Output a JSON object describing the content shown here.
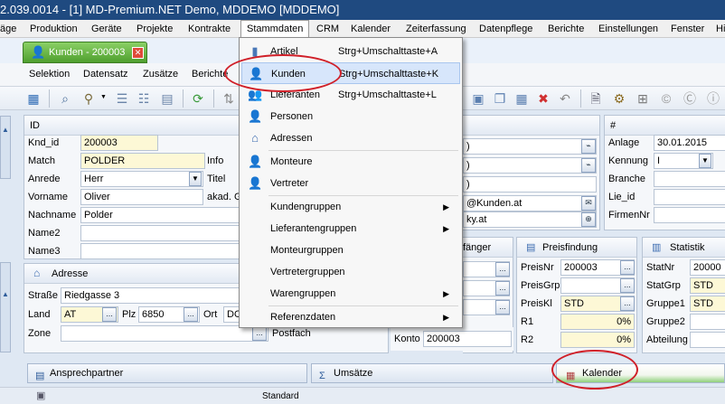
{
  "title": "2.039.0014 - [1] MD-Premium.NET Demo, MDDEMO [MDDEMO]",
  "menu": [
    "äge",
    "Produktion",
    "Geräte",
    "Projekte",
    "Kontrakte",
    "Stammdaten",
    "CRM",
    "Kalender",
    "Zeiterfassung",
    "Datenpflege",
    "Berichte",
    "Einstellungen",
    "Fenster",
    "Hilfe"
  ],
  "doc_tab": {
    "label": "Kunden - 200003"
  },
  "submenu": [
    "Selektion",
    "Datensatz",
    "Zusätze",
    "Berichte"
  ],
  "dropdown": [
    {
      "label": "Artikel",
      "shortcut": "Strg+Umschalttaste+A",
      "icon": "article-icon"
    },
    {
      "label": "Kunden",
      "shortcut": "Strg+Umschalttaste+K",
      "icon": "customer-icon",
      "highlighted": true
    },
    {
      "label": "Lieferanten",
      "shortcut": "Strg+Umschalttaste+L",
      "icon": "supplier-icon"
    },
    {
      "label": "Personen",
      "shortcut": "",
      "icon": "person-icon"
    },
    {
      "label": "Adressen",
      "shortcut": "",
      "icon": "address-icon"
    },
    {
      "label": "Monteure",
      "shortcut": "",
      "icon": "fitter-icon"
    },
    {
      "label": "Vertreter",
      "shortcut": "",
      "icon": "representative-icon"
    },
    {
      "label": "Kundengruppen",
      "shortcut": "",
      "submenu": true
    },
    {
      "label": "Lieferantengruppen",
      "shortcut": "",
      "submenu": true
    },
    {
      "label": "Monteurgruppen",
      "shortcut": "",
      "submenu": false
    },
    {
      "label": "Vertretergruppen",
      "shortcut": "",
      "submenu": false
    },
    {
      "label": "Warengruppen",
      "shortcut": "",
      "submenu": true
    },
    {
      "label": "Referenzdaten",
      "shortcut": "",
      "submenu": true
    }
  ],
  "id_panel": {
    "header": "ID",
    "knd_id_label": "Knd_id",
    "knd_id": "200003",
    "match_label": "Match",
    "match": "POLDER",
    "anrede_label": "Anrede",
    "anrede": "Herr",
    "vorname_label": "Vorname",
    "vorname": "Oliver",
    "nachname_label": "Nachname",
    "nachname": "Polder",
    "name2_label": "Name2",
    "name3_label": "Name3",
    "info_label": "Info",
    "titel_label": "Titel",
    "akad_label": "akad. G"
  },
  "contact_partial": {
    "r1": ")",
    "r2": ")",
    "r3": ")",
    "r4": "@Kunden.at",
    "r5": "ky.at"
  },
  "right_panel": {
    "header": "#",
    "anlage_label": "Anlage",
    "anlage": "30.01.2015",
    "kennung_label": "Kennung",
    "kennung": "I",
    "branche_label": "Branche",
    "lie_id_label": "Lie_id",
    "firmennr_label": "FirmenNr"
  },
  "adresse_panel": {
    "header": "Adresse",
    "strasse_label": "Straße",
    "strasse": "Riedgasse 3",
    "land_label": "Land",
    "land": "AT",
    "plz_label": "Plz",
    "plz": "6850",
    "ort_label": "Ort",
    "ort": "DO",
    "zone_label": "Zone",
    "postfach_label": "Postfach"
  },
  "empfaenger_panel": {
    "header": "fänger",
    "konto_label": "Konto",
    "konto": "200003"
  },
  "preisfindung_panel": {
    "header": "Preisfindung",
    "preisnr_label": "PreisNr",
    "preisnr": "200003",
    "preisgrp_label": "PreisGrp",
    "preiskl_label": "PreisKl",
    "preiskl": "STD",
    "r1_label": "R1",
    "r1": "0%",
    "r2_label": "R2",
    "r2": "0%"
  },
  "statistik_panel": {
    "header": "Statistik",
    "statnr_label": "StatNr",
    "statnr": "20000",
    "statgrp_label": "StatGrp",
    "statgrp": "STD",
    "gruppe1_label": "Gruppe1",
    "gruppe1": "STD",
    "gruppe2_label": "Gruppe2",
    "abteilung_label": "Abteilung"
  },
  "bottom_tabs": [
    "Ansprechpartner",
    "Umsätze",
    "Kalender"
  ],
  "bottom_strip_text": "Standard"
}
